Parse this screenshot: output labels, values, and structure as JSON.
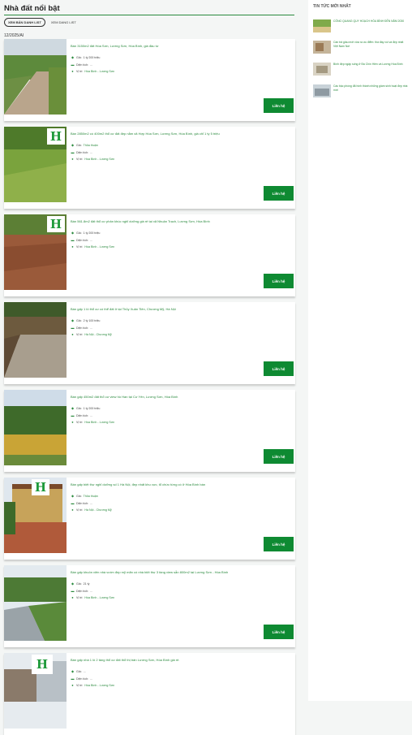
{
  "page_title": "Nhà đất nổi bật",
  "view_toggle": {
    "list": "XEM BẢN DANH LIST",
    "grid": "XEM DANG LIST"
  },
  "date": "12/2025/AI",
  "contact_label": "Liên hệ",
  "labels": {
    "price": "Giá:",
    "area": "Diện tích:",
    "location": "Vị trí:"
  },
  "listings": [
    {
      "title": "Bán 3150m2 đất Hòa Sơn, Lương Sơn, Hòa Bình, giá đầu tư",
      "price": "1 tỷ 200 triệu",
      "area": "...",
      "location": "Hòa Bình - Lương Sơn"
    },
    {
      "title": "Bán 2850m2 có 400m2 thổ cư đất đẹp nằm xã Hợp Hòa Sơn, Lương Sơn, Hòa Bình, giá chỉ 1 tỷ 5 triệu",
      "price": "Thỏa thuận",
      "area": "...",
      "location": "Hòa Bình - Lương Sơn"
    },
    {
      "title": "Bán 561.8m2 đất thổ cư phân khúc nghỉ dưỡng giá rẻ tại xã Nhuận Trạch, Lương Sơn, Hòa Bình",
      "price": "1 tỷ 200 triệu",
      "area": "...",
      "location": "Hòa Bình - Lương Sơn"
    },
    {
      "title": "Bán gấp 1 lô thổ cư có thể đất ở tại Thủy Xuân Tiên, Chương Mỹ, Hà Nội",
      "price": "2 tỷ 100 triệu",
      "area": "...",
      "location": "Hà Nội - Chương Mỹ"
    },
    {
      "title": "Bán gấp 450m2 đất thổ cư view hồ Han tại Cư Yên, Lương Sơn, Hòa Bình",
      "price": "1 tỷ 200 triệu",
      "area": "...",
      "location": "Hòa Bình - Lương Sơn"
    },
    {
      "title": "Bán gấp biệt thự nghỉ dưỡng số 1 Hà Nội, đẹp nhất khu vực, tổ chức từng có ở Hòa Bình bán",
      "price": "Thỏa thuận",
      "area": "...",
      "location": "Hà Nội - Chương Mỹ"
    },
    {
      "title": "Bán gấp khuôn viên nhà vườn đẹp mỹ mãn có nhà biệt thự 3 tầng view sẵn 800m2 tại Lương Sơn - Hòa Bình",
      "price": "21 tỷ",
      "area": "...",
      "location": "Hòa Bình - Lương Sơn"
    },
    {
      "title": "Bán gấp nhà 1 lô 2 tầng thổ cư đất thổ thị trấn Lương Sơn, Hòa Bình giá rẻ.",
      "price": "...",
      "area": "...",
      "location": "Hòa Bình - Lương Sơn"
    }
  ],
  "sidebar": {
    "title": "TIN TỨC MỚI NHẤT",
    "news": [
      {
        "title": "CÔNG QUANG QUY HOẠCH HÒA BÌNH ĐẾN NĂM 2030"
      },
      {
        "title": "Cần trả giàu mới vừa ra ưu điểm: thà đầy vùi và đẹp nhất Việt Nam Nơi"
      },
      {
        "title": "Bình đẹp ngập sống ở Đà Chín Hiền và Lương Hòa Bình"
      },
      {
        "title": "Các bậc phòng đã hình thành những giám sinh hoạt đẹp nhà mới"
      }
    ]
  },
  "colors": {
    "accent": "#0e8a32",
    "link": "#2a8a3e"
  }
}
